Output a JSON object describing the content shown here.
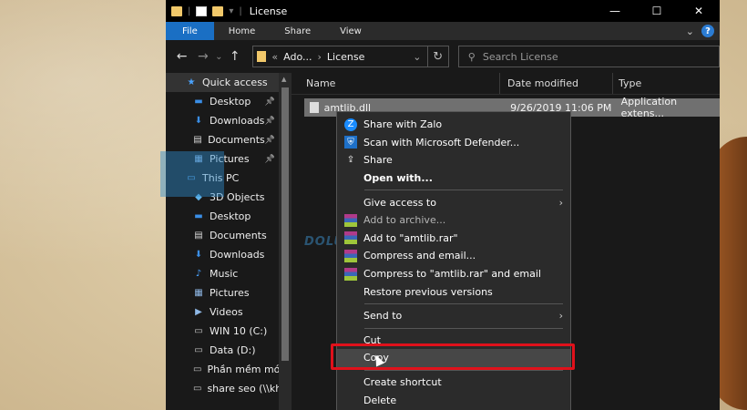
{
  "window": {
    "title": "License",
    "controls": {
      "minimize": "—",
      "maximize": "☐",
      "close": "✕"
    }
  },
  "ribbon": {
    "tabs": [
      "File",
      "Home",
      "Share",
      "View"
    ],
    "help": "?"
  },
  "nav": {
    "back": "←",
    "forward": "→",
    "recent": "⌄",
    "up": "↑",
    "address_prefix": "«",
    "address_parts": [
      "Ado...",
      "License"
    ],
    "address_sep": "›",
    "refresh": "↻",
    "search_placeholder": "Search License"
  },
  "navpane": {
    "items": [
      {
        "label": "Quick access",
        "icon": "star-icon",
        "level": 1,
        "selected": true
      },
      {
        "label": "Desktop",
        "icon": "desktop-icon",
        "level": 2,
        "pinned": true
      },
      {
        "label": "Downloads",
        "icon": "download-icon",
        "level": 2,
        "pinned": true
      },
      {
        "label": "Documents",
        "icon": "document-icon",
        "level": 2,
        "pinned": true
      },
      {
        "label": "Pictures",
        "icon": "pictures-icon",
        "level": 2,
        "pinned": true
      },
      {
        "label": "This PC",
        "icon": "pc-icon",
        "level": 1
      },
      {
        "label": "3D Objects",
        "icon": "cube-icon",
        "level": 2
      },
      {
        "label": "Desktop",
        "icon": "desktop-icon",
        "level": 2
      },
      {
        "label": "Documents",
        "icon": "document-icon",
        "level": 2
      },
      {
        "label": "Downloads",
        "icon": "download-icon",
        "level": 2
      },
      {
        "label": "Music",
        "icon": "music-icon",
        "level": 2
      },
      {
        "label": "Pictures",
        "icon": "pictures-icon",
        "level": 2
      },
      {
        "label": "Videos",
        "icon": "video-icon",
        "level": 2
      },
      {
        "label": "WIN 10 (C:)",
        "icon": "drive-icon",
        "level": 2
      },
      {
        "label": "Data (D:)",
        "icon": "drive-icon",
        "level": 2
      },
      {
        "label": "Phần mềm mới I",
        "icon": "drive-icon",
        "level": 2
      },
      {
        "label": "share seo (\\\\khai",
        "icon": "network-drive-icon",
        "level": 2
      }
    ]
  },
  "columns": {
    "name": "Name",
    "date": "Date modified",
    "type": "Type"
  },
  "file": {
    "name": "amtlib.dll",
    "date": "9/26/2019 11:06 PM",
    "type": "Application extens..."
  },
  "watermark": "DOLUAN SERVICE",
  "context_menu": {
    "items": [
      {
        "label": "Share with Zalo",
        "icon": "zalo-icon"
      },
      {
        "label": "Scan with Microsoft Defender...",
        "icon": "defender-icon"
      },
      {
        "label": "Share",
        "icon": "share-icon"
      },
      {
        "label": "Open with...",
        "bold": true
      },
      {
        "sep": true
      },
      {
        "label": "Give access to",
        "submenu": true
      },
      {
        "label": "Add to archive...",
        "icon": "winrar-icon",
        "dim": true
      },
      {
        "label": "Add to \"amtlib.rar\"",
        "icon": "winrar-icon"
      },
      {
        "label": "Compress and email...",
        "icon": "winrar-icon"
      },
      {
        "label": "Compress to \"amtlib.rar\" and email",
        "icon": "winrar-icon"
      },
      {
        "label": "Restore previous versions"
      },
      {
        "sep": true
      },
      {
        "label": "Send to",
        "submenu": true
      },
      {
        "sep": true
      },
      {
        "label": "Cut"
      },
      {
        "label": "Copy",
        "highlight": true
      },
      {
        "sep": true
      },
      {
        "label": "Create shortcut"
      },
      {
        "label": "Delete"
      }
    ]
  }
}
